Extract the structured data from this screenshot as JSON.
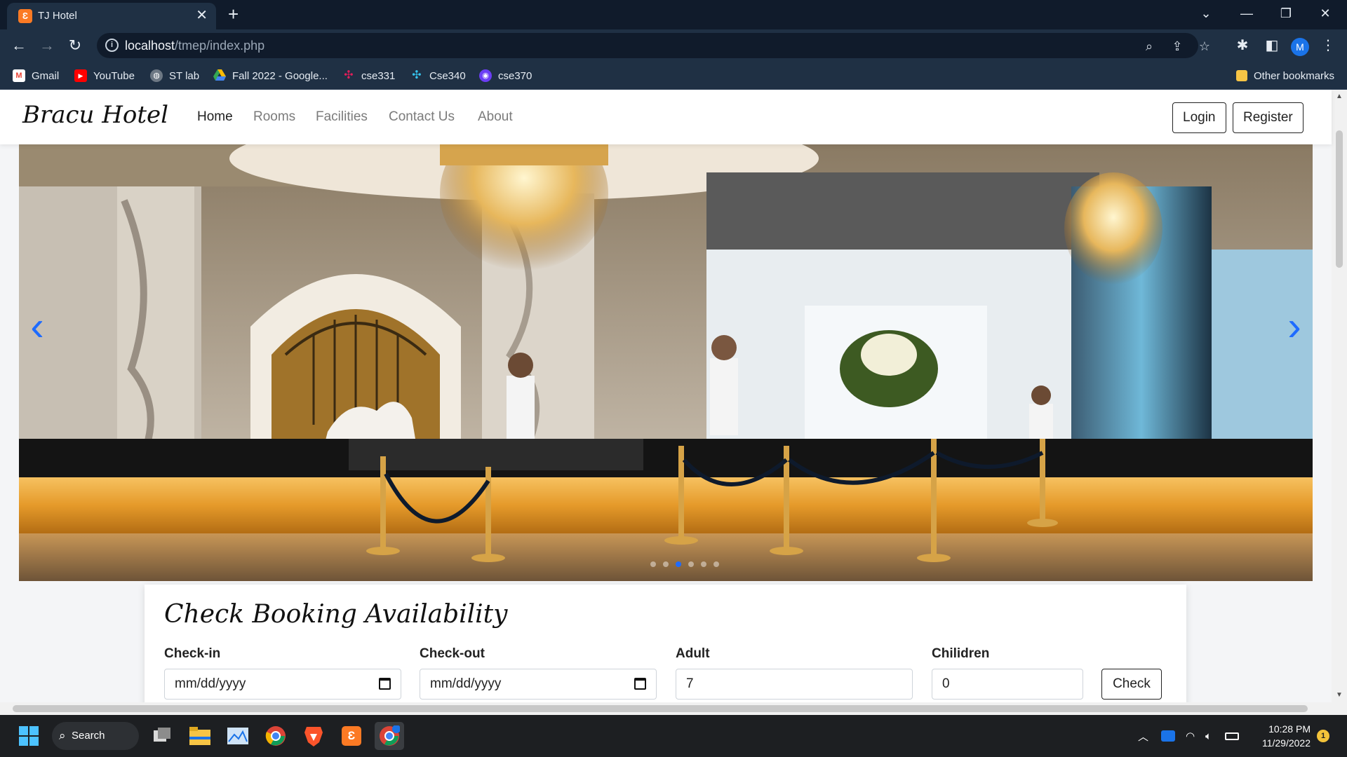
{
  "browser": {
    "tab_title": "TJ Hotel",
    "tab_favicon_text": "ꟿ",
    "new_tab": "+",
    "url_host": "localhost",
    "url_path": "/tmep/index.php",
    "profile_initial": "M",
    "bookmarks": [
      {
        "label": "Gmail",
        "icon": "gmail-icon",
        "color": "#ea4335"
      },
      {
        "label": "YouTube",
        "icon": "youtube-icon",
        "color": "#ff0000"
      },
      {
        "label": "ST lab",
        "icon": "globe-icon",
        "color": "#9aa7b6"
      },
      {
        "label": "Fall 2022 - Google...",
        "icon": "google-drive-icon",
        "color": "#34a853"
      },
      {
        "label": "cse331",
        "icon": "slack-icon",
        "color": "#e01e5a"
      },
      {
        "label": "Cse340",
        "icon": "slack-icon",
        "color": "#36c5f0"
      },
      {
        "label": "cse370",
        "icon": "badge-icon",
        "color": "#6b3df5"
      }
    ],
    "other_bookmarks": "Other bookmarks"
  },
  "site": {
    "brand": "Bracu Hotel",
    "nav": [
      "Home",
      "Rooms",
      "Facilities",
      "Contact Us",
      "About"
    ],
    "login": "Login",
    "register": "Register"
  },
  "carousel": {
    "prev": "‹",
    "next": "›",
    "slide_count": 6,
    "active_slide": 3
  },
  "booking": {
    "title": "Check Booking Availability",
    "checkin_label": "Check-in",
    "checkin_value": "mm/dd/yyyy",
    "checkout_label": "Check-out",
    "checkout_value": "mm/dd/yyyy",
    "adult_label": "Adult",
    "adult_value": "7",
    "children_label": "Chilidren",
    "children_value": "0",
    "check_button": "Check"
  },
  "taskbar": {
    "search": "Search",
    "time": "10:28 PM",
    "date": "11/29/2022",
    "notification_count": "1"
  },
  "colors": {
    "accent": "#1e6bff",
    "chrome_dark": "#101b2b",
    "chrome_toolbar": "#1f3044"
  }
}
